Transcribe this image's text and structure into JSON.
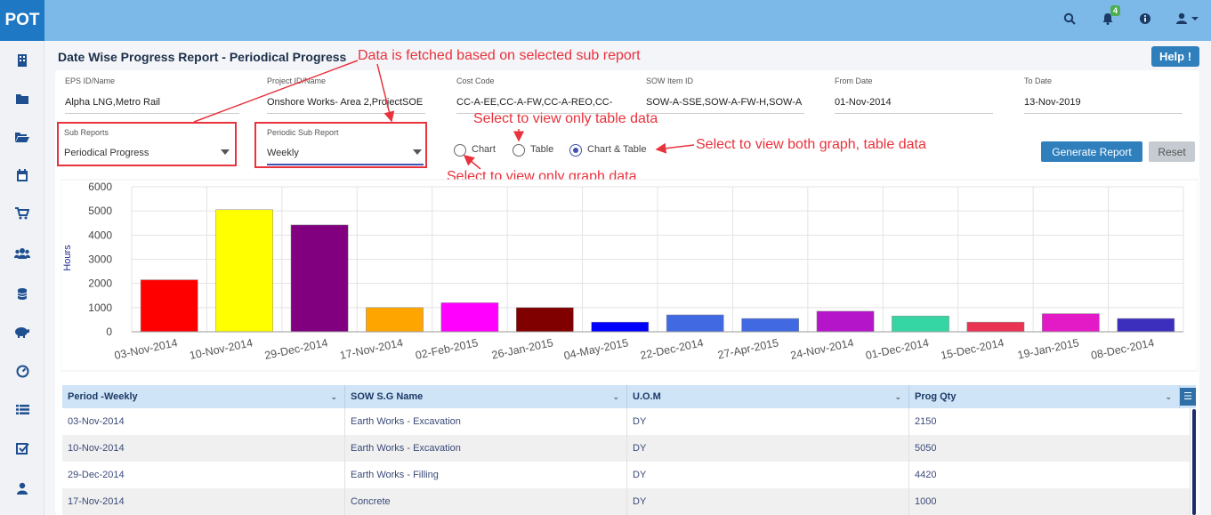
{
  "app": {
    "logo": "POT",
    "notification_count": "4"
  },
  "header_icons": [
    "search-icon",
    "bell-icon",
    "info-icon",
    "user-icon"
  ],
  "sidebar_icons": [
    "building-icon",
    "folder-icon",
    "folder-open-icon",
    "calendar-icon",
    "cart-icon",
    "users-icon",
    "database-icon",
    "piggy-bank-icon",
    "dashboard-icon",
    "list-icon",
    "checkbox-icon",
    "person-icon"
  ],
  "page": {
    "title": "Date Wise Progress Report - Periodical Progress",
    "help_label": "Help !"
  },
  "filters": {
    "eps": {
      "label": "EPS ID/Name",
      "value": "Alpha LNG,Metro Rail"
    },
    "project": {
      "label": "Project ID/Name",
      "value": "Onshore  Works- Area 2,ProjectSOE"
    },
    "cost_code": {
      "label": "Cost Code",
      "value": "CC-A-EE,CC-A-FW,CC-A-REO,CC-"
    },
    "sow_item": {
      "label": "SOW Item ID",
      "value": "SOW-A-SSE,SOW-A-FW-H,SOW-A"
    },
    "from_date": {
      "label": "From Date",
      "value": "01-Nov-2014"
    },
    "to_date": {
      "label": "To Date",
      "value": "13-Nov-2019"
    }
  },
  "sub_reports": {
    "label": "Sub Reports",
    "value": "Periodical Progress"
  },
  "periodic_sub_report": {
    "label": "Periodic Sub Report",
    "value": "Weekly"
  },
  "view_options": {
    "chart": "Chart",
    "table": "Table",
    "chart_table": "Chart & Table",
    "selected": "chart_table"
  },
  "buttons": {
    "generate": "Generate Report",
    "reset": "Reset"
  },
  "annotations": {
    "data_fetch": "Data is fetched based on selected sub report",
    "table_only": "Select to view only table data",
    "both": "Select to view both graph, table data",
    "graph_only": "Select to view only graph data"
  },
  "chart_data": {
    "type": "bar",
    "ylabel": "Hours",
    "ylim": [
      0,
      6000
    ],
    "yticks": [
      0,
      1000,
      2000,
      3000,
      4000,
      5000,
      6000
    ],
    "grid": true,
    "categories": [
      "03-Nov-2014",
      "10-Nov-2014",
      "29-Dec-2014",
      "17-Nov-2014",
      "02-Feb-2015",
      "26-Jan-2015",
      "04-May-2015",
      "22-Dec-2014",
      "27-Apr-2015",
      "24-Nov-2014",
      "01-Dec-2014",
      "15-Dec-2014",
      "19-Jan-2015",
      "08-Dec-2014"
    ],
    "values": [
      2150,
      5050,
      4420,
      1000,
      1200,
      1000,
      400,
      700,
      550,
      850,
      650,
      400,
      750,
      550
    ],
    "colors": [
      "#ff0000",
      "#ffff00",
      "#800080",
      "#ffa500",
      "#ff00ff",
      "#800000",
      "#0000ff",
      "#4169e1",
      "#4169e1",
      "#b515c9",
      "#35d6a4",
      "#e83353",
      "#e21bc7",
      "#3d2fbd"
    ]
  },
  "table": {
    "columns": [
      "Period -Weekly",
      "SOW S.G Name",
      "U.O.M",
      "Prog Qty"
    ],
    "rows": [
      [
        "03-Nov-2014",
        "Earth Works - Excavation",
        "DY",
        "2150"
      ],
      [
        "10-Nov-2014",
        "Earth Works - Excavation",
        "DY",
        "5050"
      ],
      [
        "29-Dec-2014",
        "Earth Works - Filling",
        "DY",
        "4420"
      ],
      [
        "17-Nov-2014",
        "Concrete",
        "DY",
        "1000"
      ]
    ]
  }
}
